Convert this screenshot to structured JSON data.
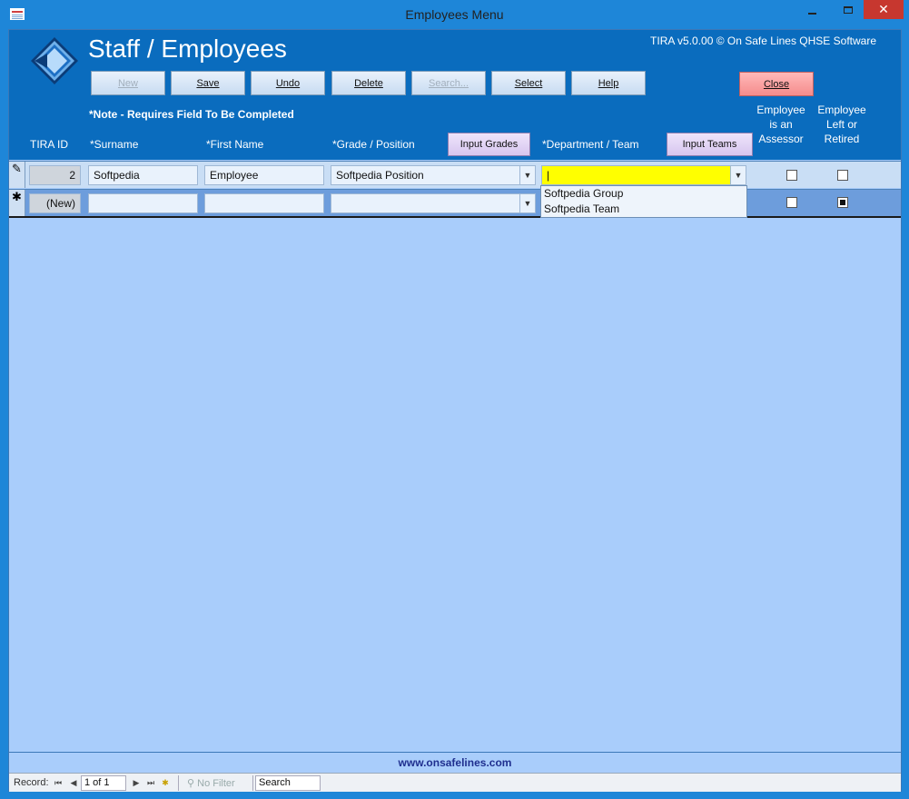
{
  "window": {
    "title": "Employees Menu"
  },
  "header": {
    "title": "Staff / Employees",
    "version": "TIRA v5.0.00 © On Safe Lines QHSE Software",
    "note": "*Note - Requires Field To Be Completed"
  },
  "toolbar": {
    "new": "New",
    "save": "Save",
    "undo": "Undo",
    "delete": "Delete",
    "search": "Search...",
    "select": "Select",
    "help": "Help",
    "close": "Close"
  },
  "columns": {
    "tira_id": "TIRA ID",
    "surname": "*Surname",
    "first_name": "*First Name",
    "grade": "*Grade / Position",
    "input_grades": "Input Grades",
    "department": "*Department / Team",
    "input_teams": "Input Teams",
    "assessor": "Employee is an Assessor",
    "left": "Employee Left or Retired"
  },
  "rows": [
    {
      "id": "2",
      "surname": "Softpedia",
      "first_name": "Employee",
      "grade": "Softpedia Position",
      "department": "|",
      "assessor": false,
      "left": false
    },
    {
      "id": "(New)",
      "surname": "",
      "first_name": "",
      "grade": "",
      "department": "",
      "assessor": false,
      "left": true
    }
  ],
  "dropdown_options": [
    "Softpedia Group",
    "Softpedia Team"
  ],
  "footer": {
    "website": "www.onsafelines.com"
  },
  "navigation": {
    "record_label": "Record:",
    "position": "1 of 1",
    "filter": "No Filter",
    "search": "Search"
  },
  "colors": {
    "header_bg": "#0a6cbe",
    "body_bg": "#a9cdfb",
    "close_btn": "#f58c8c",
    "required_field": "#ffff00"
  }
}
